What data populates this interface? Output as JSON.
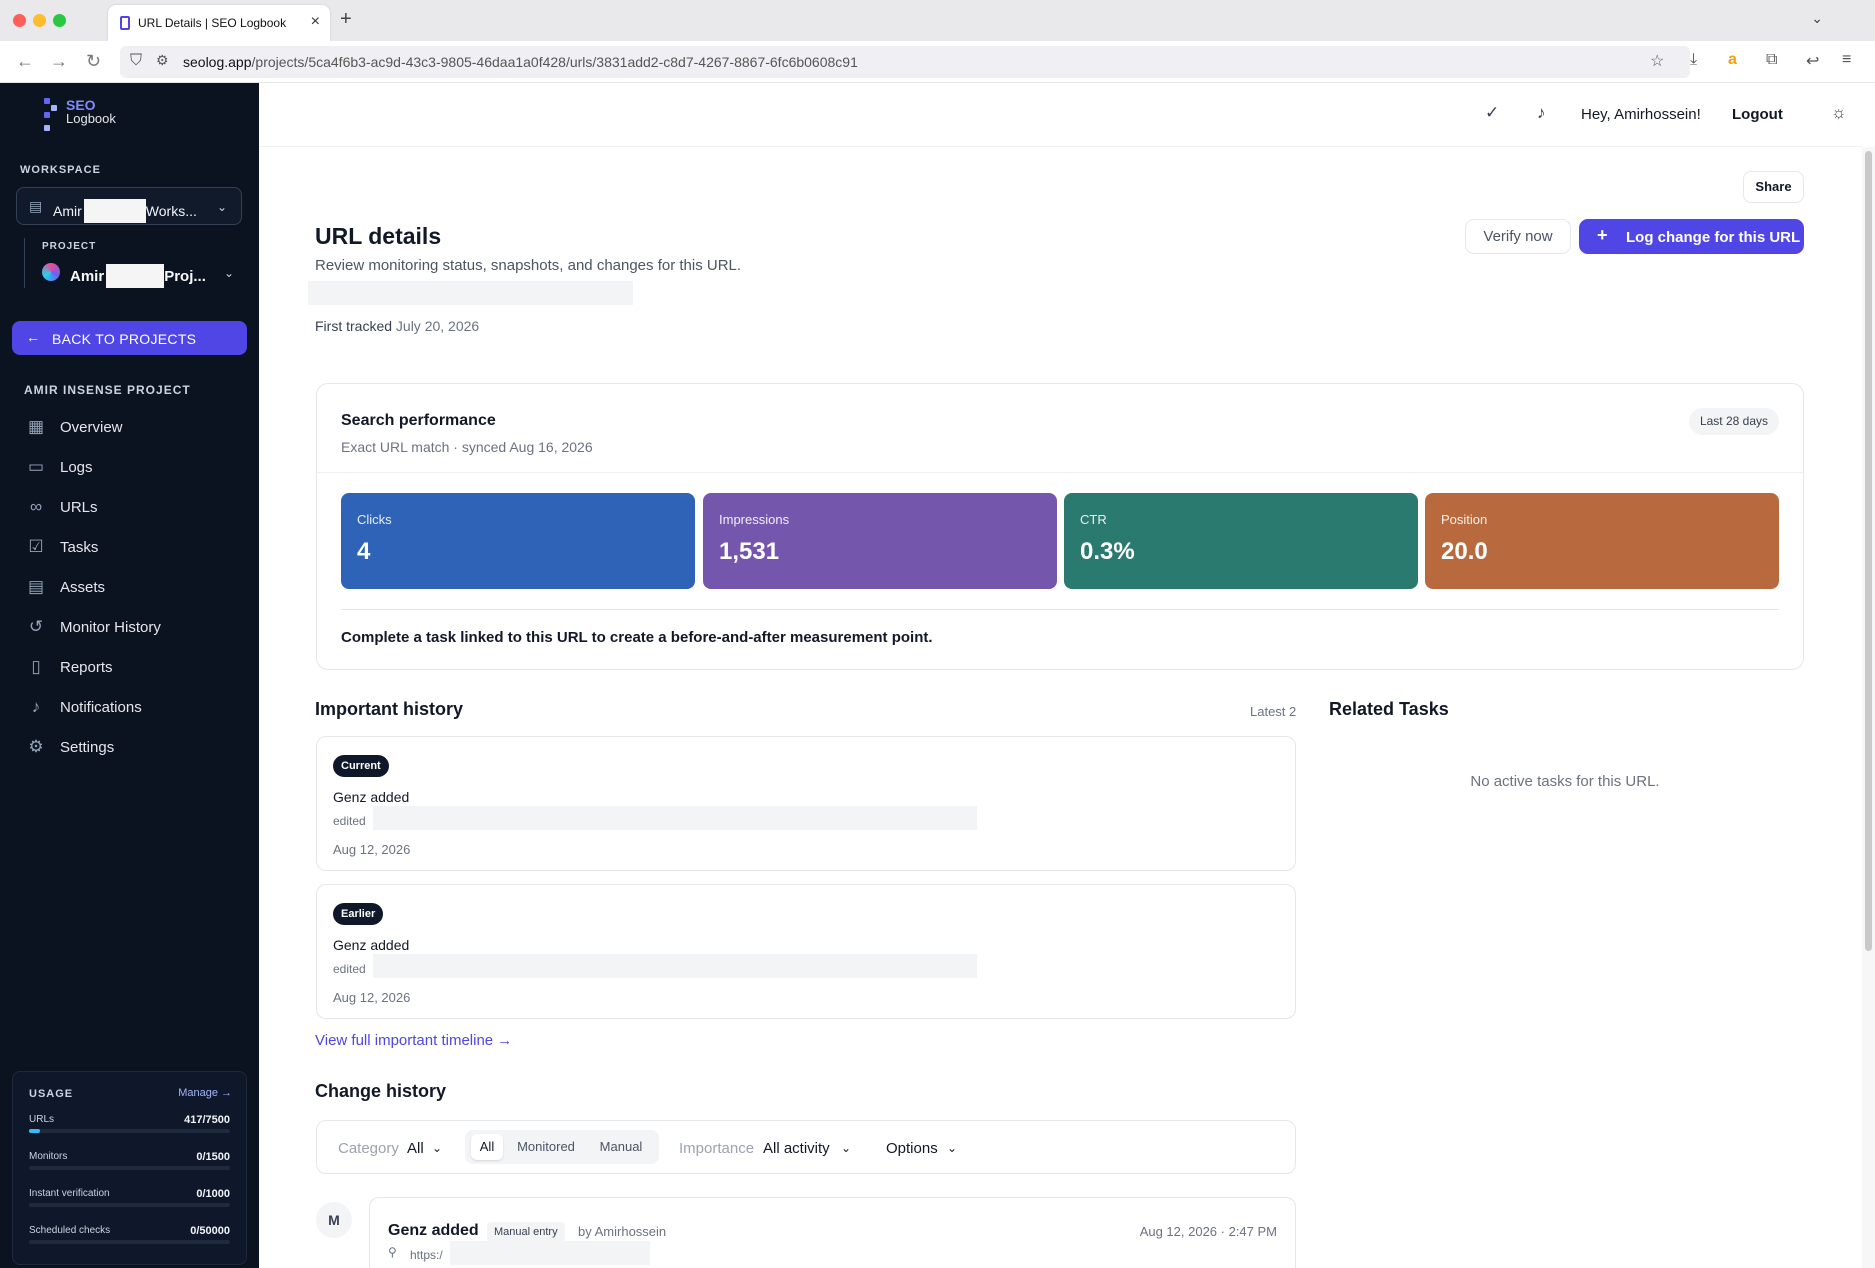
{
  "browser": {
    "tab_title": "URL Details | SEO Logbook",
    "url_host": "seolog.app",
    "url_path": "/projects/5ca4f6b3-ac9d-43c3-9805-46daa1a0f428/urls/3831add2-c8d7-4267-8867-6fc6b0608c91"
  },
  "sidebar": {
    "logo_line1": "SEO",
    "logo_line2": "Logbook",
    "workspace_label": "WORKSPACE",
    "workspace_prefix": "Amir",
    "workspace_suffix": "Works...",
    "project_label": "PROJECT",
    "project_prefix": "Amir",
    "project_suffix": "Proj...",
    "back_label": "BACK TO PROJECTS",
    "section_label": "AMIR INSENSE PROJECT",
    "items": [
      {
        "label": "Overview",
        "icon": "grid-icon"
      },
      {
        "label": "Logs",
        "icon": "document-icon"
      },
      {
        "label": "URLs",
        "icon": "link-icon"
      },
      {
        "label": "Tasks",
        "icon": "checkbox-icon"
      },
      {
        "label": "Assets",
        "icon": "building-icon"
      },
      {
        "label": "Monitor History",
        "icon": "history-icon"
      },
      {
        "label": "Reports",
        "icon": "clipboard-icon"
      },
      {
        "label": "Notifications",
        "icon": "bell-icon"
      },
      {
        "label": "Settings",
        "icon": "gear-icon"
      }
    ],
    "usage": {
      "title": "USAGE",
      "manage": "Manage →",
      "rows": [
        {
          "label": "URLs",
          "value": "417/7500",
          "fraction": 0.056
        },
        {
          "label": "Monitors",
          "value": "0/1500",
          "fraction": 0
        },
        {
          "label": "Instant verification",
          "value": "0/1000",
          "fraction": 0
        },
        {
          "label": "Scheduled checks",
          "value": "0/50000",
          "fraction": 0
        }
      ]
    }
  },
  "topbar": {
    "greeting": "Hey, Amirhossein!",
    "logout": "Logout"
  },
  "page": {
    "share": "Share",
    "title": "URL details",
    "subtitle": "Review monitoring status, snapshots, and changes for this URL.",
    "first_tracked_label": "First tracked",
    "first_tracked_date": "July 20, 2026",
    "verify_now": "Verify now",
    "log_change": "Log change for this URL"
  },
  "performance": {
    "title": "Search performance",
    "subtitle": "Exact URL match · synced Aug 16, 2026",
    "range": "Last 28 days",
    "metrics": [
      {
        "label": "Clicks",
        "value": "4",
        "color": "#2f63b8"
      },
      {
        "label": "Impressions",
        "value": "1,531",
        "color": "#7457ad"
      },
      {
        "label": "CTR",
        "value": "0.3%",
        "color": "#2a7a70"
      },
      {
        "label": "Position",
        "value": "20.0",
        "color": "#b86a3e"
      }
    ],
    "note": "Complete a task linked to this URL to create a before-and-after measurement point."
  },
  "important_history": {
    "title": "Important history",
    "latest": "Latest 2",
    "items": [
      {
        "badge": "Current",
        "title": "Genz added",
        "edited": "edited",
        "date": "Aug 12, 2026"
      },
      {
        "badge": "Earlier",
        "title": "Genz added",
        "edited": "edited",
        "date": "Aug 12, 2026"
      }
    ],
    "timeline_link": "View full important timeline →"
  },
  "related_tasks": {
    "title": "Related Tasks",
    "empty": "No active tasks for this URL."
  },
  "change_history": {
    "title": "Change history",
    "category_label": "Category",
    "category_value": "All",
    "segments": [
      "All",
      "Monitored",
      "Manual"
    ],
    "importance_label": "Importance",
    "importance_value": "All activity",
    "options": "Options",
    "entry": {
      "avatar": "M",
      "title": "Genz added",
      "badge": "Manual entry",
      "by": "by Amirhossein",
      "date": "Aug 12, 2026 · 2:47 PM",
      "url_prefix": "https:/"
    }
  }
}
